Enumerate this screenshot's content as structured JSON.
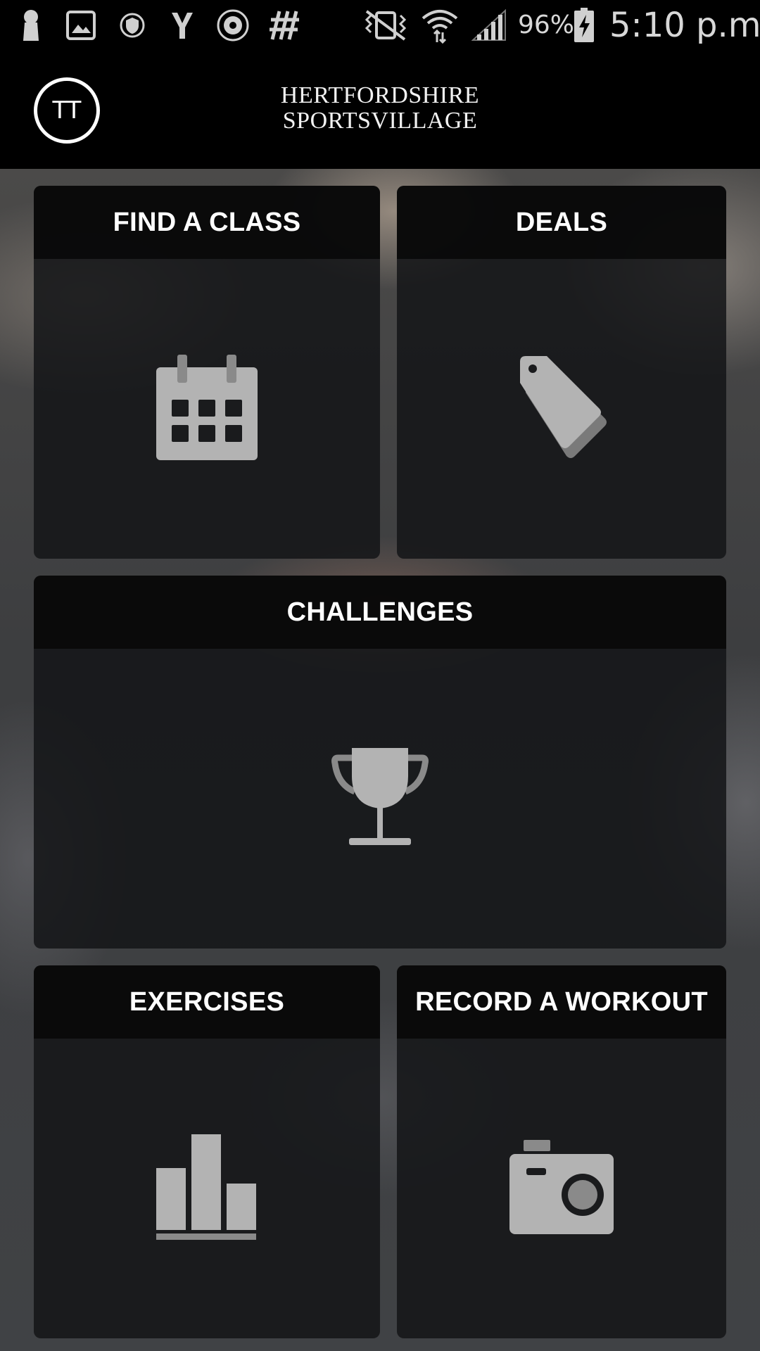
{
  "status_bar": {
    "icons": [
      "notification-icon",
      "gallery-icon",
      "shield-icon",
      "yahoo-icon",
      "settings-app-icon",
      "hashtag-app-icon",
      "vibrate-icon",
      "wifi-icon",
      "signal-icon",
      "battery-charging-icon"
    ],
    "battery": "96%",
    "time": "5:10 p.m."
  },
  "header": {
    "avatar_initials": "TT",
    "brand_line1": "HERTFORDSHIRE",
    "brand_line2": "SPORTSVILLAGE"
  },
  "tiles": [
    {
      "label": "FIND A CLASS",
      "icon": "calendar-icon"
    },
    {
      "label": "DEALS",
      "icon": "tag-icon"
    },
    {
      "label": "CHALLENGES",
      "icon": "trophy-icon"
    },
    {
      "label": "EXERCISES",
      "icon": "bar-chart-icon"
    },
    {
      "label": "RECORD A WORKOUT",
      "icon": "camera-icon"
    }
  ],
  "colors": {
    "header_bg": "#000000",
    "tile_header_bg": "#080808",
    "tile_body_bg": "#141517",
    "icon_fill": "#b3b3b3",
    "text": "#ffffff"
  }
}
